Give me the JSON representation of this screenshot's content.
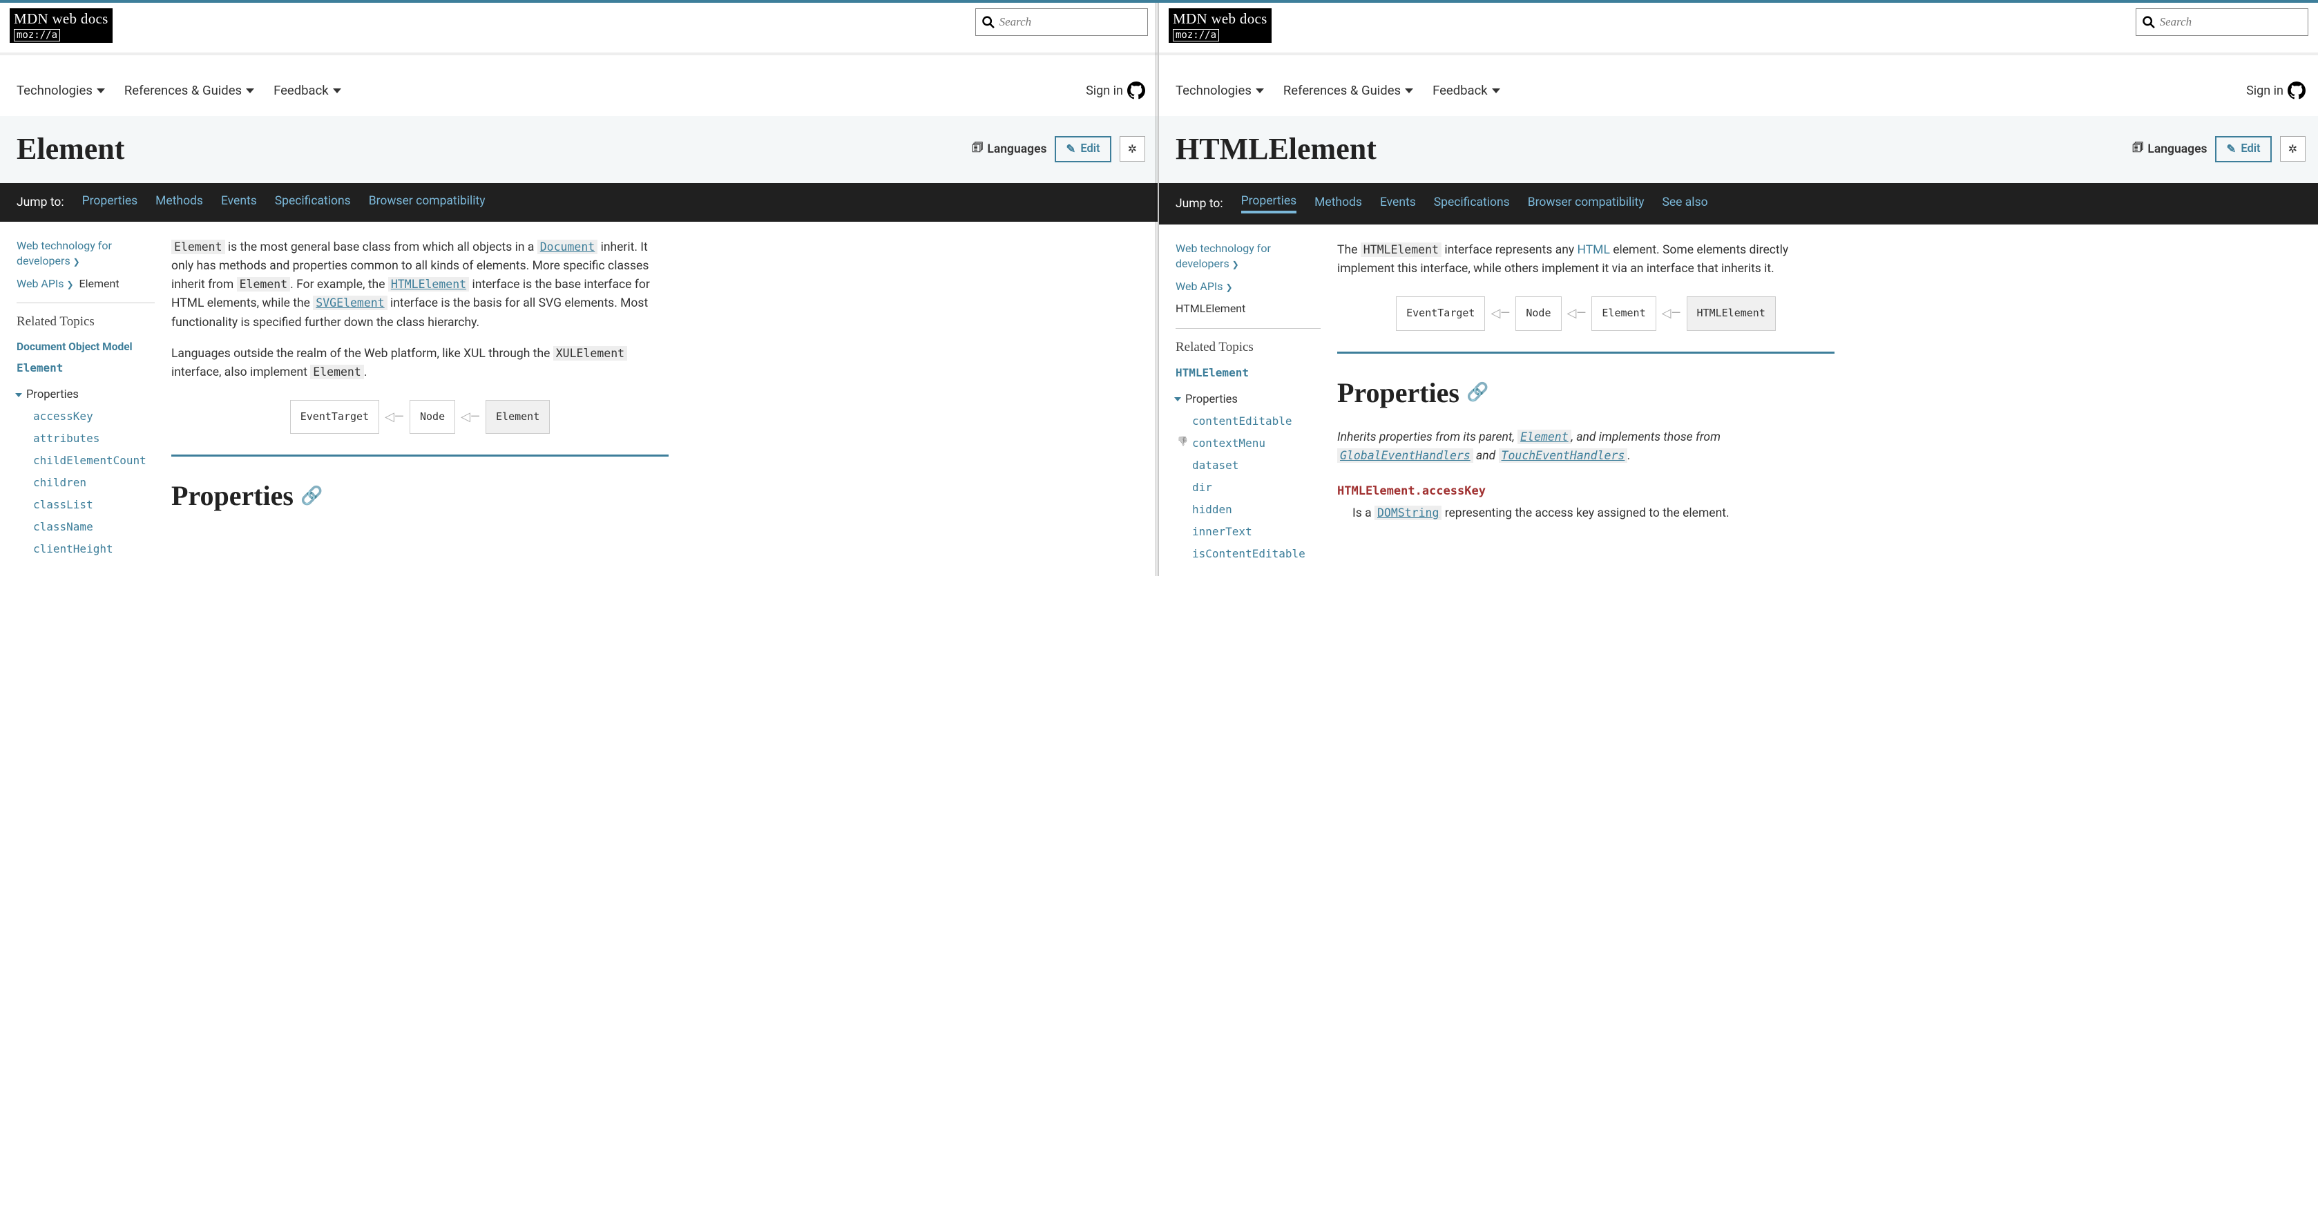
{
  "logo": {
    "main": "MDN web docs",
    "sub": "moz://a"
  },
  "search_placeholder": "Search",
  "nav": {
    "tech": "Technologies",
    "ref": "References & Guides",
    "feedback": "Feedback",
    "signin": "Sign in"
  },
  "langs_label": "Languages",
  "edit_label": "Edit",
  "jump_label": "Jump to:",
  "jump": {
    "props": "Properties",
    "methods": "Methods",
    "events": "Events",
    "specs": "Specifications",
    "compat": "Browser compatibility",
    "seealso": "See also"
  },
  "related_heading": "Related Topics",
  "props_toggle": "Properties",
  "props_section": "Properties",
  "left": {
    "title": "Element",
    "crumbs": {
      "c1": "Web technology for developers",
      "c2": "Web APIs",
      "c3": "Element"
    },
    "topics": {
      "t1": "Document Object Model",
      "t2": "Element"
    },
    "props": [
      "accessKey",
      "attributes",
      "childElementCount",
      "children",
      "classList",
      "className",
      "clientHeight"
    ],
    "intro": {
      "t1": "Element",
      "s1": " is the most general base class from which all objects in a ",
      "t2": "Document",
      "s2": " inherit. It only has methods and properties common to all kinds of elements. More specific classes inherit from ",
      "t3": "Element",
      "s3": ". For example, the ",
      "t4": "HTMLElement",
      "s4": " interface is the base interface for HTML elements, while the ",
      "t5": "SVGElement",
      "s5": " interface is the basis for all SVG elements. Most functionality is specified further down the class hierarchy."
    },
    "intro2": {
      "s1": "Languages outside the realm of the Web platform, like XUL through the ",
      "t1": "XULElement",
      "s2": " interface, also implement ",
      "t2": "Element",
      "s3": "."
    },
    "chain": [
      "EventTarget",
      "Node",
      "Element"
    ]
  },
  "right": {
    "title": "HTMLElement",
    "crumbs": {
      "c1": "Web technology for developers",
      "c2": "Web APIs",
      "c3": "HTMLElement"
    },
    "topics": {
      "t1": "HTMLElement"
    },
    "props": [
      "contentEditable",
      "contextMenu",
      "dataset",
      "dir",
      "hidden",
      "innerText",
      "isContentEditable"
    ],
    "intro": {
      "s1": "The ",
      "t1": "HTMLElement",
      "s2": " interface represents any ",
      "l1": "HTML",
      "s3": " element. Some elements directly implement this interface, while others implement it via an interface that inherits it."
    },
    "chain": [
      "EventTarget",
      "Node",
      "Element",
      "HTMLElement"
    ],
    "inherits": {
      "s1": "Inherits properties from its parent, ",
      "t1": "Element",
      "s2": ", and implements those from ",
      "t2": "GlobalEventHandlers",
      "s3": " and ",
      "t3": "TouchEventHandlers",
      "s4": "."
    },
    "dl": {
      "term1": "HTMLElement.accessKey",
      "def1a": "Is a ",
      "def1b": "DOMString",
      "def1c": " representing the access key assigned to the element."
    }
  }
}
